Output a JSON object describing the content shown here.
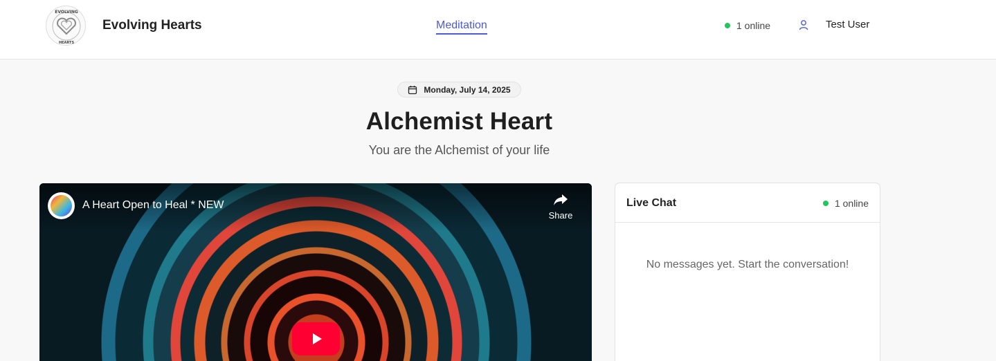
{
  "header": {
    "brand_name": "Evolving Hearts",
    "nav_active": "Meditation",
    "online_text": "1 online",
    "user_name": "Test User"
  },
  "page": {
    "date": "Monday, July 14, 2025",
    "title": "Alchemist Heart",
    "subtitle": "You are the Alchemist of your life"
  },
  "video": {
    "title": "A Heart Open to Heal * NEW",
    "share_label": "Share"
  },
  "chat": {
    "title": "Live Chat",
    "online_text": "1 online",
    "empty_text": "No messages yet. Start the conversation!"
  },
  "colors": {
    "accent": "#4a5ad8",
    "online": "#22c55e",
    "youtube_red": "#ff0033"
  },
  "icons": {
    "logo": "evolving-hearts-logo",
    "calendar": "calendar-icon",
    "user": "user-icon",
    "share": "share-icon",
    "play": "play-icon"
  }
}
